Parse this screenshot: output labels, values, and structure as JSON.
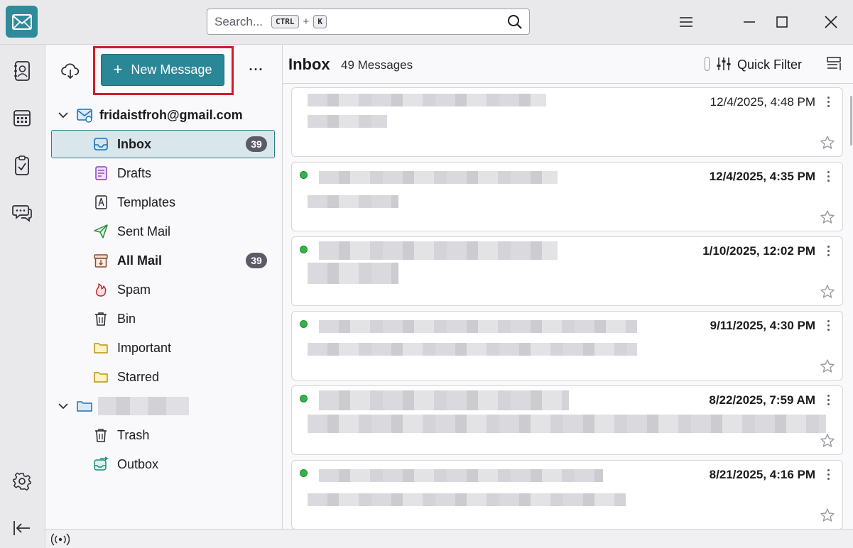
{
  "search": {
    "placeholder": "Search...",
    "kbd_ctrl": "CTRL",
    "plus": "+",
    "kbd_key": "K"
  },
  "toolbar": {
    "new_message": "New Message",
    "more": "···",
    "plus_icon": "+"
  },
  "account": {
    "email": "fridaistfroh@gmail.com"
  },
  "folders": [
    {
      "name": "Inbox",
      "count": "39",
      "icon": "inbox-icon"
    },
    {
      "name": "Drafts",
      "icon": "drafts-icon"
    },
    {
      "name": "Templates",
      "icon": "templates-icon"
    },
    {
      "name": "Sent Mail",
      "icon": "sent-icon"
    },
    {
      "name": "All Mail",
      "count": "39",
      "icon": "archive-icon"
    },
    {
      "name": "Spam",
      "icon": "spam-icon"
    },
    {
      "name": "Bin",
      "icon": "trash-icon"
    },
    {
      "name": "Important",
      "icon": "folder-icon"
    },
    {
      "name": "Starred",
      "icon": "folder-icon"
    }
  ],
  "local_folders": [
    {
      "name": "Trash",
      "icon": "trash-icon"
    },
    {
      "name": "Outbox",
      "icon": "outbox-icon"
    }
  ],
  "thread": {
    "title": "Inbox",
    "count_label": "49 Messages",
    "quick_filter": "Quick Filter"
  },
  "messages": [
    {
      "date": "12/4/2025, 4:48 PM",
      "unread": false
    },
    {
      "date": "12/4/2025, 4:35 PM",
      "unread": true
    },
    {
      "date": "1/10/2025, 12:02 PM",
      "unread": true
    },
    {
      "date": "9/11/2025, 4:30 PM",
      "unread": true
    },
    {
      "date": "8/22/2025, 7:59 AM",
      "unread": true
    },
    {
      "date": "8/21/2025, 4:16 PM",
      "unread": true
    }
  ],
  "colors": {
    "accent": "#2a8797",
    "highlight": "#d11a2a",
    "unread_dot": "#35b34a"
  }
}
